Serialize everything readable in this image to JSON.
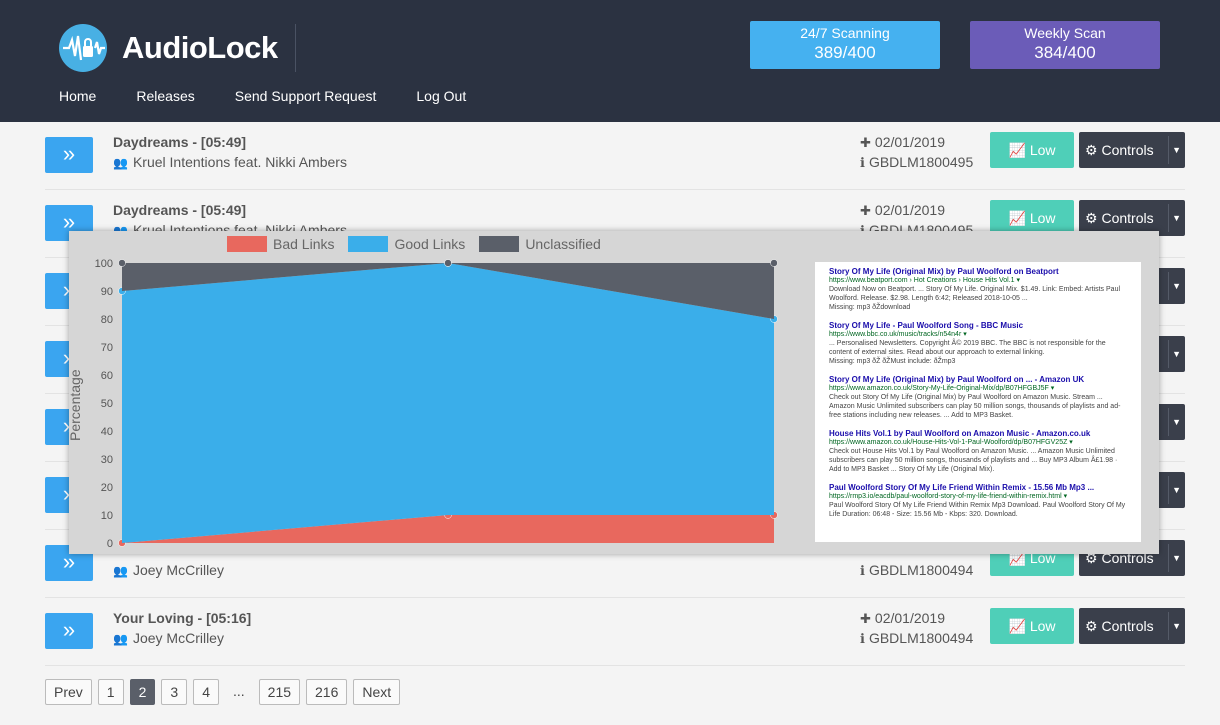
{
  "header": {
    "logo_text": "AudioLock",
    "nav": [
      "Home",
      "Releases",
      "Send Support Request",
      "Log Out"
    ],
    "scan_247": {
      "label": "24/7 Scanning",
      "value": "389/400"
    },
    "scan_weekly": {
      "label": "Weekly Scan",
      "value": "384/400"
    }
  },
  "rows": [
    {
      "title": "Daydreams - [05:49]",
      "artist": "Kruel Intentions feat. Nikki Ambers",
      "date": "02/01/2019",
      "code": "GBDLM1800495",
      "low": "Low",
      "controls": "Controls"
    },
    {
      "title": "Daydreams - [05:49]",
      "artist": "Kruel Intentions feat. Nikki Ambers",
      "date": "02/01/2019",
      "code": "GBDLM1800495",
      "low": "Low",
      "controls": "Controls"
    },
    {
      "title": "",
      "artist": "Joey McCrilley",
      "date": "",
      "code": "GBDLM1800494",
      "low": "Low",
      "controls": "Controls"
    },
    {
      "title": "Your Loving - [05:16]",
      "artist": "Joey McCrilley",
      "date": "02/01/2019",
      "code": "GBDLM1800494",
      "low": "Low",
      "controls": "Controls"
    }
  ],
  "pagination": [
    "Prev",
    "1",
    "2",
    "3",
    "4",
    "...",
    "215",
    "216",
    "Next"
  ],
  "pagination_active": "2",
  "chart_data": {
    "type": "area",
    "stacked": true,
    "x": [
      0,
      1,
      2
    ],
    "series": [
      {
        "name": "Bad Links",
        "values": [
          0,
          10,
          10
        ],
        "color": "#e8685e"
      },
      {
        "name": "Good Links",
        "values": [
          90,
          90,
          70
        ],
        "color": "#3aaeea"
      },
      {
        "name": "Unclassified",
        "values": [
          10,
          0,
          20
        ],
        "color": "#5a5f69"
      }
    ],
    "yticks": [
      "0",
      "10",
      "20",
      "30",
      "40",
      "50",
      "60",
      "70",
      "80",
      "90",
      "100"
    ],
    "ylim": [
      0,
      100
    ],
    "ylabel": "Percentage",
    "legend": "top"
  },
  "serp": [
    {
      "title": "Story Of My Life (Original Mix) by Paul Woolford on Beatport",
      "url": "https://www.beatport.com › Hot Creations › House Hits Vol.1 ▾",
      "snippet": "Download Now on Beatport. ... Story Of My Life. Original Mix. $1.49. Link: Embed: Artists Paul Woolford. Release. $2.98. Length 6:42; Released 2018-10-05 ...",
      "missing": "Missing: mp3 ‎ðŽdownload"
    },
    {
      "title": "Story Of My Life - Paul Woolford Song - BBC Music",
      "url": "https://www.bbc.co.uk/music/tracks/n54n4r ▾",
      "snippet": "... Personalised Newsletters. Copyright Â© 2019 BBC. The BBC is not responsible for the content of external sites. Read about our approach to external linking.",
      "missing": "Missing: mp3 ‎ðŽ ‎ðŽMust include: ‎ðŽmp3"
    },
    {
      "title": "Story Of My Life (Original Mix) by Paul Woolford on ... - Amazon UK",
      "url": "https://www.amazon.co.uk/Story-My-Life-Original-Mix/dp/B07HFGBJ5F ▾",
      "snippet": "Check out Story Of My Life (Original Mix) by Paul Woolford on Amazon Music. Stream ... Amazon Music Unlimited subscribers can play 50 million songs, thousands of playlists and ad-free stations including new releases. ... Add to MP3 Basket.",
      "missing": ""
    },
    {
      "title": "House Hits Vol.1 by Paul Woolford on Amazon Music - Amazon.co.uk",
      "url": "https://www.amazon.co.uk/House-Hits-Vol-1-Paul-Woolford/dp/B07HFGV25Z ▾",
      "snippet": "Check out House Hits Vol.1 by Paul Woolford on Amazon Music. ... Amazon Music Unlimited subscribers can play 50 million songs, thousands of playlists and ... Buy MP3 Album Â£1.98 · Add to MP3 Basket ... Story Of My Life (Original Mix).",
      "missing": ""
    },
    {
      "title": "Paul Woolford Story Of My Life Friend Within Remix - 15.56 Mb Mp3 ...",
      "url": "https://rmp3.io/eacdb/paul-woolford-story-of-my-life-friend-within-remix.html ▾",
      "snippet": "Paul Woolford Story Of My Life Friend Within Remix Mp3 Download. Paul Woolford Story Of My Life Duration: 06:48 - Size: 15.56 Mb - Kbps: 320. Download.",
      "missing": ""
    }
  ]
}
